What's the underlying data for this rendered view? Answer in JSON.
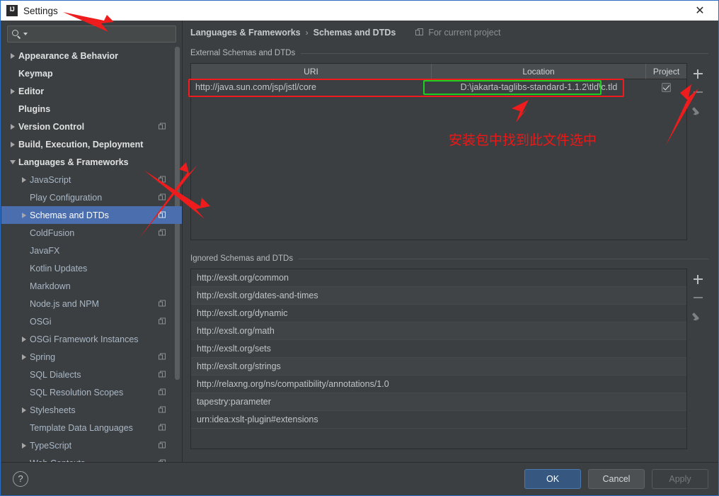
{
  "window": {
    "title": "Settings",
    "logo_text": "IJ",
    "close_icon": "close-icon"
  },
  "sidebar": {
    "search": {
      "value": "",
      "placeholder": ""
    },
    "items": [
      {
        "label": "Appearance & Behavior",
        "level": 0,
        "expander": "right",
        "badge": false,
        "selected": false
      },
      {
        "label": "Keymap",
        "level": 0,
        "expander": "none",
        "badge": false,
        "selected": false
      },
      {
        "label": "Editor",
        "level": 0,
        "expander": "right",
        "badge": false,
        "selected": false
      },
      {
        "label": "Plugins",
        "level": 0,
        "expander": "none",
        "badge": false,
        "selected": false
      },
      {
        "label": "Version Control",
        "level": 0,
        "expander": "right",
        "badge": true,
        "selected": false
      },
      {
        "label": "Build, Execution, Deployment",
        "level": 0,
        "expander": "right",
        "badge": false,
        "selected": false
      },
      {
        "label": "Languages & Frameworks",
        "level": 0,
        "expander": "down",
        "badge": false,
        "selected": false
      },
      {
        "label": "JavaScript",
        "level": 1,
        "expander": "right",
        "badge": true,
        "selected": false
      },
      {
        "label": "Play Configuration",
        "level": 1,
        "expander": "none",
        "badge": true,
        "selected": false
      },
      {
        "label": "Schemas and DTDs",
        "level": 1,
        "expander": "right",
        "badge": true,
        "selected": true
      },
      {
        "label": "ColdFusion",
        "level": 1,
        "expander": "none",
        "badge": true,
        "selected": false
      },
      {
        "label": "JavaFX",
        "level": 1,
        "expander": "none",
        "badge": false,
        "selected": false
      },
      {
        "label": "Kotlin Updates",
        "level": 1,
        "expander": "none",
        "badge": false,
        "selected": false
      },
      {
        "label": "Markdown",
        "level": 1,
        "expander": "none",
        "badge": false,
        "selected": false
      },
      {
        "label": "Node.js and NPM",
        "level": 1,
        "expander": "none",
        "badge": true,
        "selected": false
      },
      {
        "label": "OSGi",
        "level": 1,
        "expander": "none",
        "badge": true,
        "selected": false
      },
      {
        "label": "OSGi Framework Instances",
        "level": 1,
        "expander": "right",
        "badge": false,
        "selected": false
      },
      {
        "label": "Spring",
        "level": 1,
        "expander": "right",
        "badge": true,
        "selected": false
      },
      {
        "label": "SQL Dialects",
        "level": 1,
        "expander": "none",
        "badge": true,
        "selected": false
      },
      {
        "label": "SQL Resolution Scopes",
        "level": 1,
        "expander": "none",
        "badge": true,
        "selected": false
      },
      {
        "label": "Stylesheets",
        "level": 1,
        "expander": "right",
        "badge": true,
        "selected": false
      },
      {
        "label": "Template Data Languages",
        "level": 1,
        "expander": "none",
        "badge": true,
        "selected": false
      },
      {
        "label": "TypeScript",
        "level": 1,
        "expander": "right",
        "badge": true,
        "selected": false
      },
      {
        "label": "Web Contexts",
        "level": 1,
        "expander": "none",
        "badge": true,
        "selected": false
      }
    ]
  },
  "main": {
    "breadcrumb": {
      "parent": "Languages & Frameworks",
      "separator": "›",
      "current": "Schemas and DTDs",
      "project_scope": "For current project",
      "project_scope_icon": "copy-pages-icon"
    },
    "external": {
      "section_title": "External Schemas and DTDs",
      "columns": [
        "URI",
        "Location",
        "Project"
      ],
      "rows": [
        {
          "uri": "http://java.sun.com/jsp/jstl/core",
          "location": "D:\\jakarta-taglibs-standard-1.1.2\\tld\\c.tld",
          "project": true
        }
      ],
      "tools": [
        {
          "name": "add-button",
          "icon": "plus-icon",
          "enabled": true
        },
        {
          "name": "remove-button",
          "icon": "minus-icon",
          "enabled": false
        },
        {
          "name": "edit-button",
          "icon": "pencil-icon",
          "enabled": false
        }
      ]
    },
    "ignored": {
      "section_title": "Ignored Schemas and DTDs",
      "rows": [
        "http://exslt.org/common",
        "http://exslt.org/dates-and-times",
        "http://exslt.org/dynamic",
        "http://exslt.org/math",
        "http://exslt.org/sets",
        "http://exslt.org/strings",
        "http://relaxng.org/ns/compatibility/annotations/1.0",
        "tapestry:parameter",
        "urn:idea:xslt-plugin#extensions"
      ],
      "tools": [
        {
          "name": "add-button",
          "icon": "plus-icon",
          "enabled": true
        },
        {
          "name": "remove-button",
          "icon": "minus-icon",
          "enabled": false
        },
        {
          "name": "edit-button",
          "icon": "pencil-icon",
          "enabled": false
        }
      ]
    }
  },
  "footer": {
    "help_label": "?",
    "ok_label": "OK",
    "cancel_label": "Cancel",
    "apply_label": "Apply"
  },
  "annotations": {
    "note_text": "安装包中找到此文件选中",
    "red_color": "#ee1c1c",
    "green_color": "#1fd11f"
  }
}
